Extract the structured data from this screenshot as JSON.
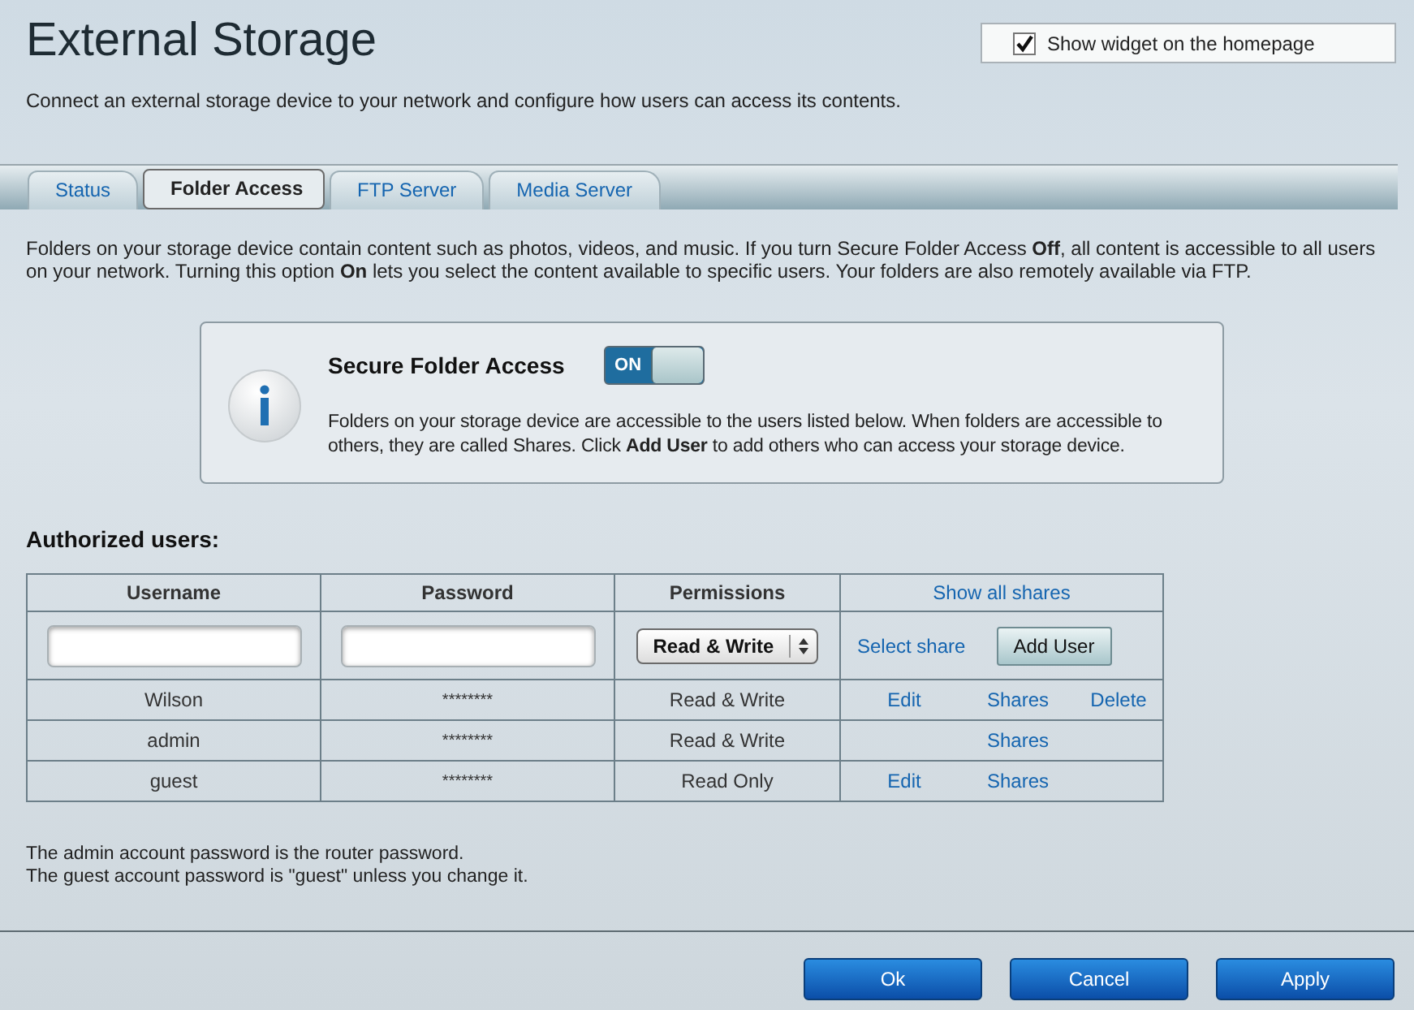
{
  "title": "External Storage",
  "widget": {
    "label": "Show widget on the homepage",
    "checked": true
  },
  "subtitle": "Connect an external storage device to your network and configure how users can access its contents.",
  "tabs": [
    {
      "label": "Status",
      "selected": false
    },
    {
      "label": "Folder Access",
      "selected": true
    },
    {
      "label": "FTP Server",
      "selected": false
    },
    {
      "label": "Media Server",
      "selected": false
    }
  ],
  "intro": "Folders on your storage device contain content such as photos, videos, and music. If you turn Secure Folder Access **Off**, all content is accessible to all users on your network. Turning this option **On** lets you select the content available to specific users. Your folders are also remotely available via FTP.",
  "info": {
    "title": "Secure Folder Access",
    "toggle": {
      "label": "ON",
      "on": true
    },
    "text": "Folders on your storage device are accessible to the users listed below. When folders are accessible to others, they are called Shares. Click **Add User** to add others who can access your storage device."
  },
  "users_heading": "Authorized users:",
  "table": {
    "columns": [
      "Username",
      "Password",
      "Permissions"
    ],
    "show_all": "Show all shares",
    "new_row": {
      "permission": "Read & Write",
      "select_share": "Select share",
      "add_button": "Add User"
    },
    "rows": [
      {
        "username": "Wilson",
        "password": "********",
        "permission": "Read & Write",
        "edit": "Edit",
        "shares": "Shares",
        "delete": "Delete"
      },
      {
        "username": "admin",
        "password": "********",
        "permission": "Read & Write",
        "shares": "Shares"
      },
      {
        "username": "guest",
        "password": "********",
        "permission": "Read Only",
        "edit": "Edit",
        "shares": "Shares"
      }
    ]
  },
  "notes": [
    "The admin account password is the router password.",
    "The guest account password is \"guest\" unless you change it."
  ],
  "buttons": [
    "Ok",
    "Cancel",
    "Apply"
  ]
}
